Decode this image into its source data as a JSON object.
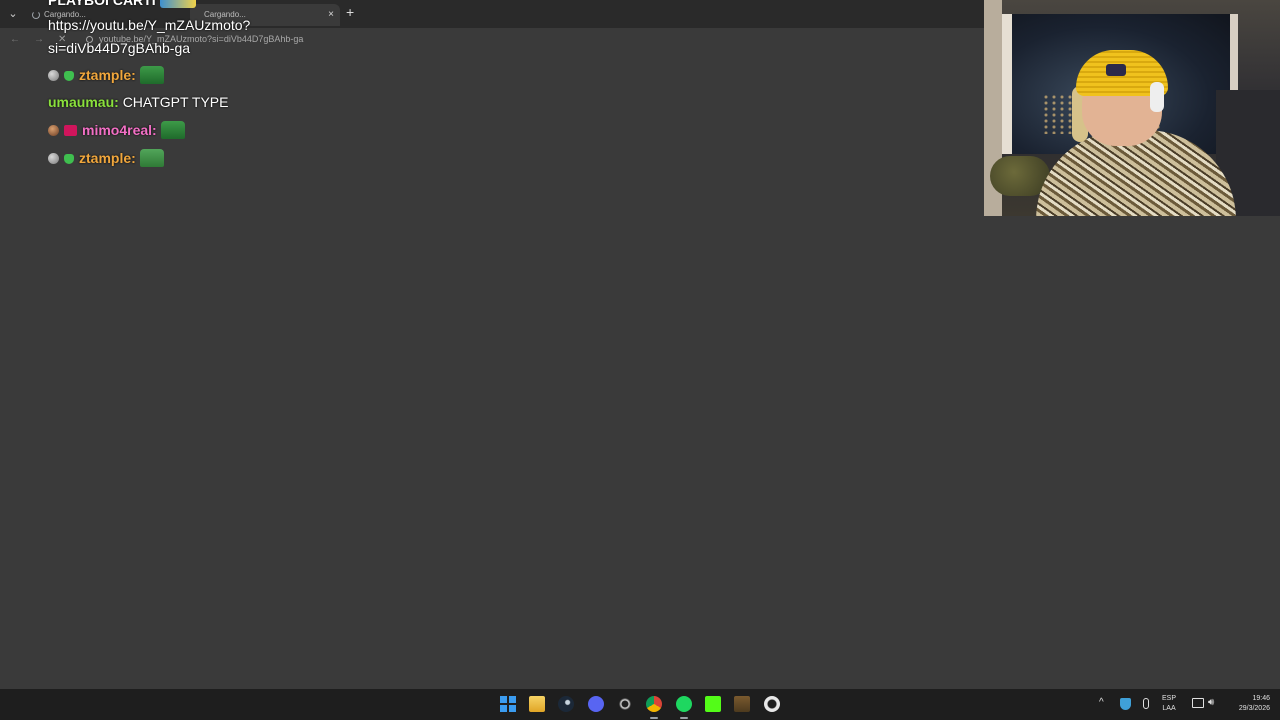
{
  "browser": {
    "tabs": [
      {
        "label": "Cargando..."
      },
      {
        "label": "Cargando..."
      }
    ],
    "new_tab_label": "+",
    "close_label": "×",
    "url": "youtube.be/Y_mZAUzmoto?si=diVb44D7gBAhb-ga"
  },
  "chat": {
    "cut_top": {
      "text": "PLAYBOI CARTI"
    },
    "link": {
      "line1": "https://youtu.be/Y_mZAUzmoto?",
      "line2": "si=diVb44D7gBAhb-ga"
    },
    "messages": [
      {
        "user": "ztample",
        "separator": ":",
        "text": "",
        "name_color": "#f0a63c"
      },
      {
        "user": "umaumau",
        "separator": ":",
        "text": "CHATGPT TYPE",
        "name_color": "#8ae03c"
      },
      {
        "user": "mimo4real",
        "separator": ":",
        "text": "",
        "name_color": "#f26fc5"
      },
      {
        "user": "ztample",
        "separator": ":",
        "text": "",
        "name_color": "#f0a63c"
      }
    ]
  },
  "taskbar": {
    "icons": [
      "windows-start-icon",
      "file-explorer-icon",
      "steam-icon",
      "discord-icon",
      "obs-icon",
      "chrome-icon",
      "spotify-icon",
      "kick-icon",
      "minecraft-icon",
      "ccleaner-icon"
    ],
    "tray": {
      "lang_line1": "ESP",
      "lang_line2": "LAA",
      "time": "19:46",
      "date": "29/3/2026"
    }
  },
  "colors": {
    "background": "#3a3a3a",
    "taskbar": "#1e1e1e"
  }
}
